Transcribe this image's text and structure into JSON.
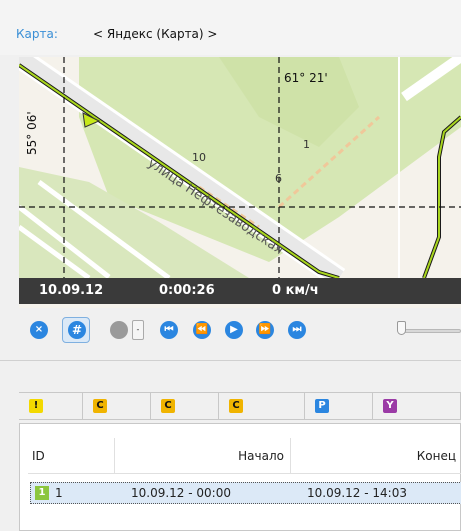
{
  "map": {
    "label": "Карта:",
    "value": "< Яндекс (Карта) >",
    "coord_lon": "61° 21'",
    "coord_lat": "55° 06'",
    "street": "улица Нефтезаводская",
    "house_10": "10",
    "house_1": "1",
    "house_6": "6"
  },
  "status": {
    "date": "10.09.12",
    "time": "0:00:26",
    "speed": "0 км/ч"
  },
  "player": {
    "close_glyph": "×",
    "grid_glyph": "#",
    "dropdown_glyph": "-",
    "first_glyph": "⏮",
    "rewind_glyph": "⏪",
    "play_glyph": "▶",
    "forward_glyph": "⏩",
    "last_glyph": "⏭",
    "progress": 0
  },
  "filters": [
    {
      "glyph": "!",
      "color": "#f3d900"
    },
    {
      "glyph": "C",
      "color": "#f0b400"
    },
    {
      "glyph": "C",
      "color": "#f0b400"
    },
    {
      "glyph": "C",
      "color": "#f0b400"
    },
    {
      "glyph": "P",
      "color": "#2b86e0"
    },
    {
      "glyph": "Y",
      "color": "#9b3ba6"
    }
  ],
  "table": {
    "headers": {
      "id": "ID",
      "start": "Начало",
      "end": "Конец"
    },
    "rows": [
      {
        "badge": "1",
        "id": "1",
        "start": "10.09.12 - 00:00",
        "end": "10.09.12 - 14:03"
      }
    ]
  }
}
